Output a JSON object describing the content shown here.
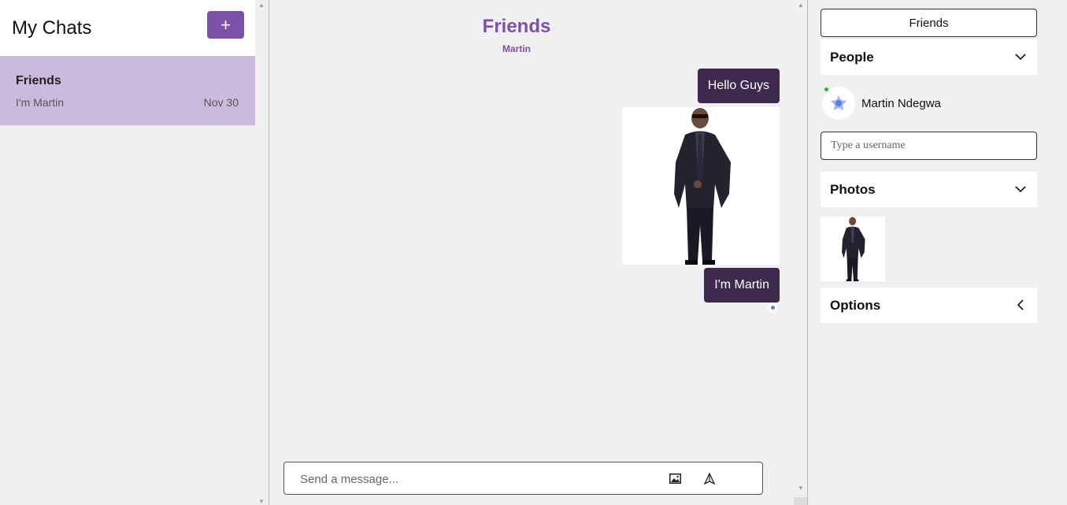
{
  "sidebar": {
    "title": "My Chats",
    "new_chat_label": "+",
    "chats": [
      {
        "name": "Friends",
        "last_message": "I'm Martin",
        "date": "Nov 30"
      }
    ]
  },
  "feed": {
    "title": "Friends",
    "subtitle": "Martin",
    "messages": [
      {
        "type": "text",
        "text": "Hello Guys"
      },
      {
        "type": "image"
      },
      {
        "type": "text",
        "text": "I'm Martin"
      }
    ],
    "input_placeholder": "Send a message..."
  },
  "settings": {
    "chat_title": "Friends",
    "people_label": "People",
    "people": [
      {
        "name": "Martin Ndegwa",
        "online": true
      }
    ],
    "username_placeholder": "Type a username",
    "photos_label": "Photos",
    "options_label": "Options"
  },
  "icons": {
    "add": "plus-icon",
    "image": "image-icon",
    "send": "send-icon",
    "expand": "chevron-down-icon",
    "collapse": "chevron-left-icon"
  },
  "colors": {
    "accent": "#7b52a8",
    "selected_chat": "#cbbadd",
    "message_bubble": "#3e2a4e",
    "online": "#2bb72b"
  }
}
